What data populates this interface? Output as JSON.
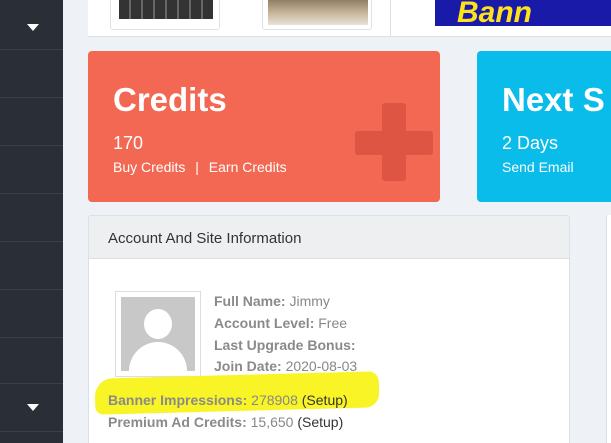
{
  "cards": {
    "credits": {
      "title": "Credits",
      "value": "170",
      "link1": "Buy Credits",
      "divider": "|",
      "link2": "Earn Credits",
      "color": "#f26852"
    },
    "next": {
      "title": "Next S",
      "value": "2 Days",
      "link1": "Send Email",
      "color": "#09bce9"
    }
  },
  "panel": {
    "title": "Account And Site Information",
    "full_name_label": "Full Name:",
    "full_name": "Jimmy",
    "level_label": "Account Level:",
    "level": "Free",
    "bonus_label": "Last Upgrade Bonus:",
    "join_label": "Join Date:",
    "join": "2020-08-03",
    "banner_label": "Banner Impressions:",
    "banner_value": "278908",
    "banner_setup": "(Setup)",
    "ad_label": "Premium Ad Credits:",
    "ad_value": "15,650",
    "ad_setup": "(Setup)"
  },
  "top": {
    "banner_text": "Bann"
  },
  "icons": {
    "sidebar_caret": "chevron-down-icon",
    "card_plus": "plus-icon",
    "avatar": "user-avatar-icon"
  },
  "colors": {
    "sidebar": "#2a2f37",
    "highlight": "#f7f312"
  }
}
